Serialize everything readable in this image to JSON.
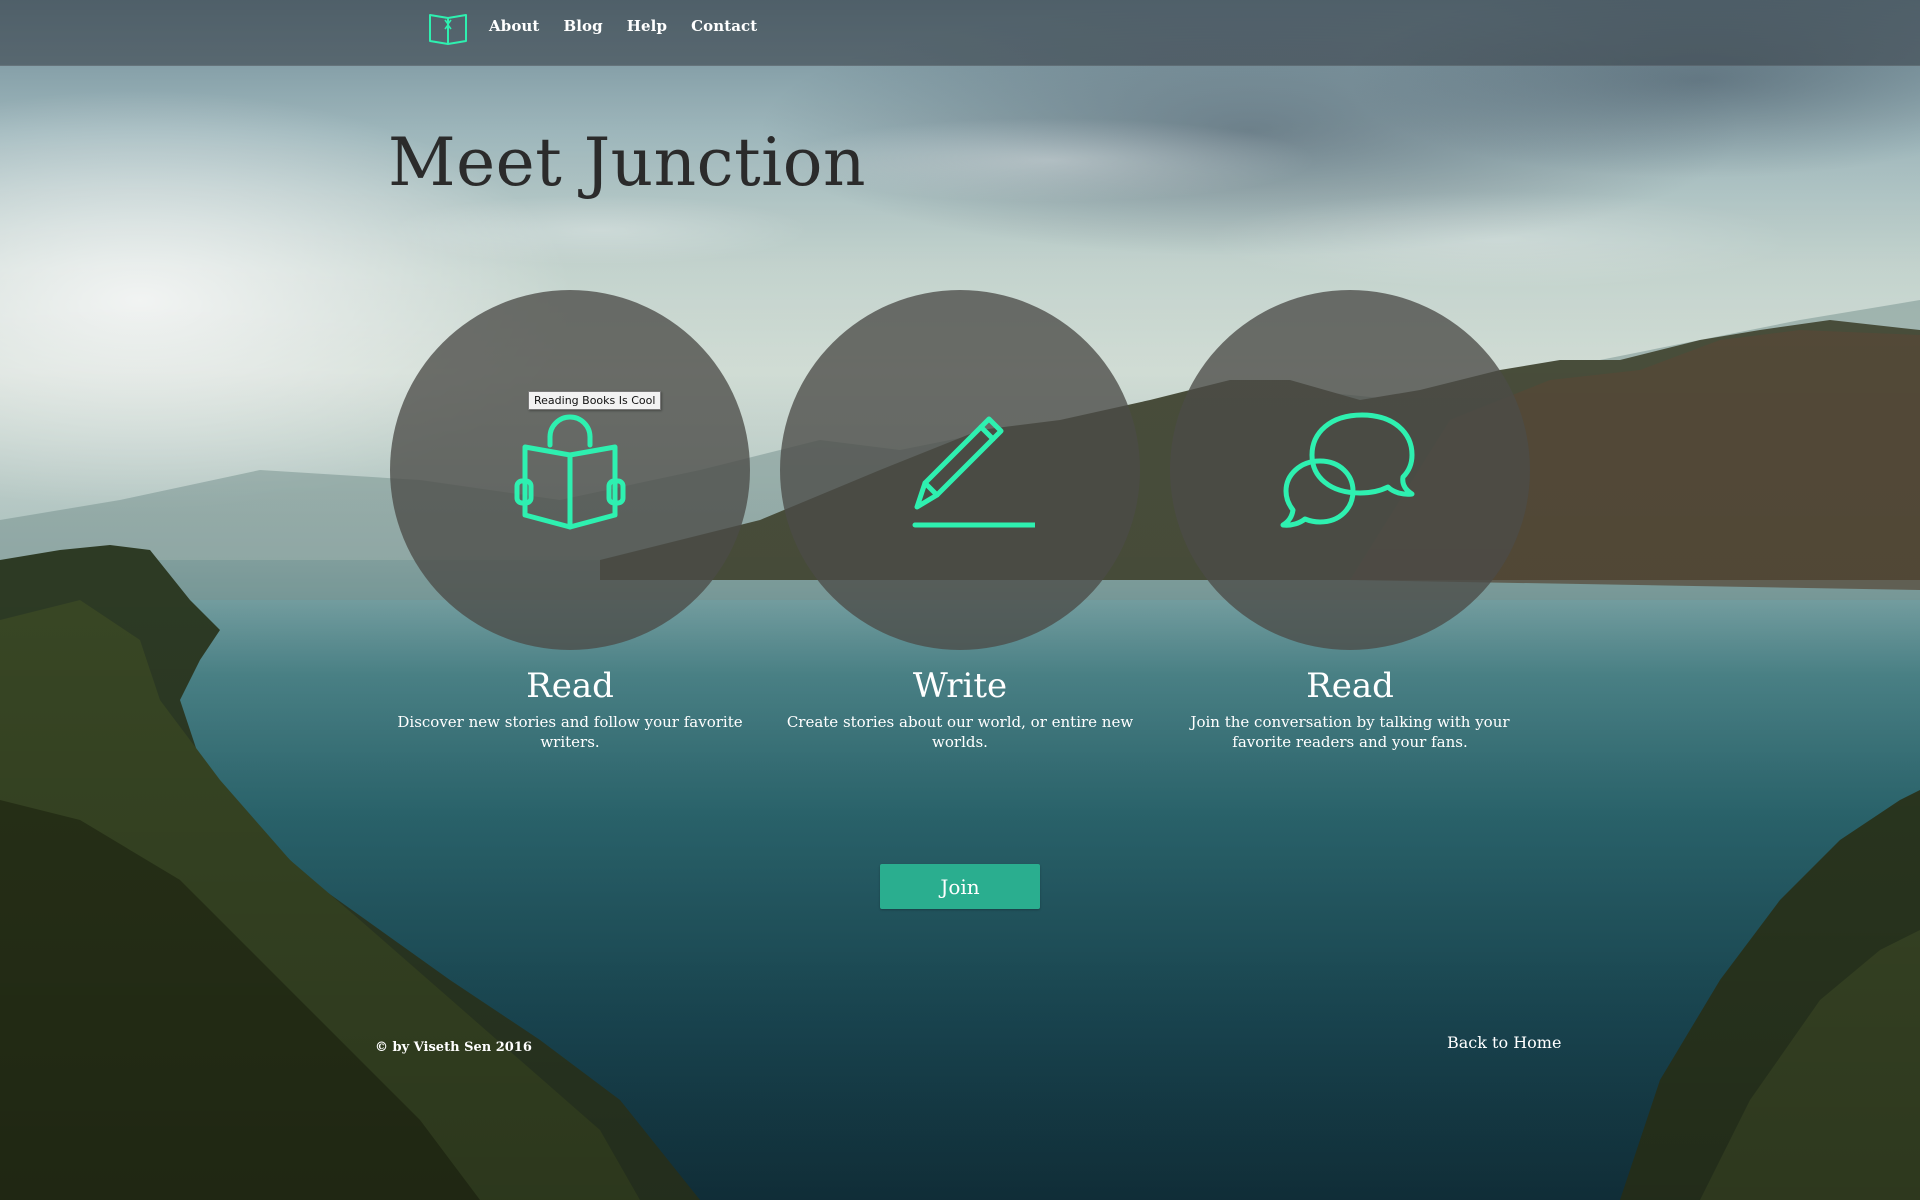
{
  "nav": {
    "logo_icon": "open-book-logo-icon",
    "links": [
      "About",
      "Blog",
      "Help",
      "Contact"
    ]
  },
  "hero": {
    "title": "Meet Junction"
  },
  "features": [
    {
      "icon": "reading-person-icon",
      "heading": "Read",
      "description": "Discover new stories and follow your favorite writers."
    },
    {
      "icon": "pencil-icon",
      "heading": "Write",
      "description": "Create stories about our world, or entire new worlds."
    },
    {
      "icon": "chat-bubbles-icon",
      "heading": "Read",
      "description": "Join the conversation by talking with your favorite readers and your fans."
    }
  ],
  "tooltip": {
    "text": "Reading Books Is Cool"
  },
  "join": {
    "label": "Join"
  },
  "footer": {
    "copyright": "© by Viseth Sen 2016",
    "back_link": "Back to Home"
  },
  "colors": {
    "accent": "#2aae8f",
    "icon_green": "#2ef0b0",
    "title_text": "#2b2b2b",
    "circle_fill": "#4b4b48"
  }
}
